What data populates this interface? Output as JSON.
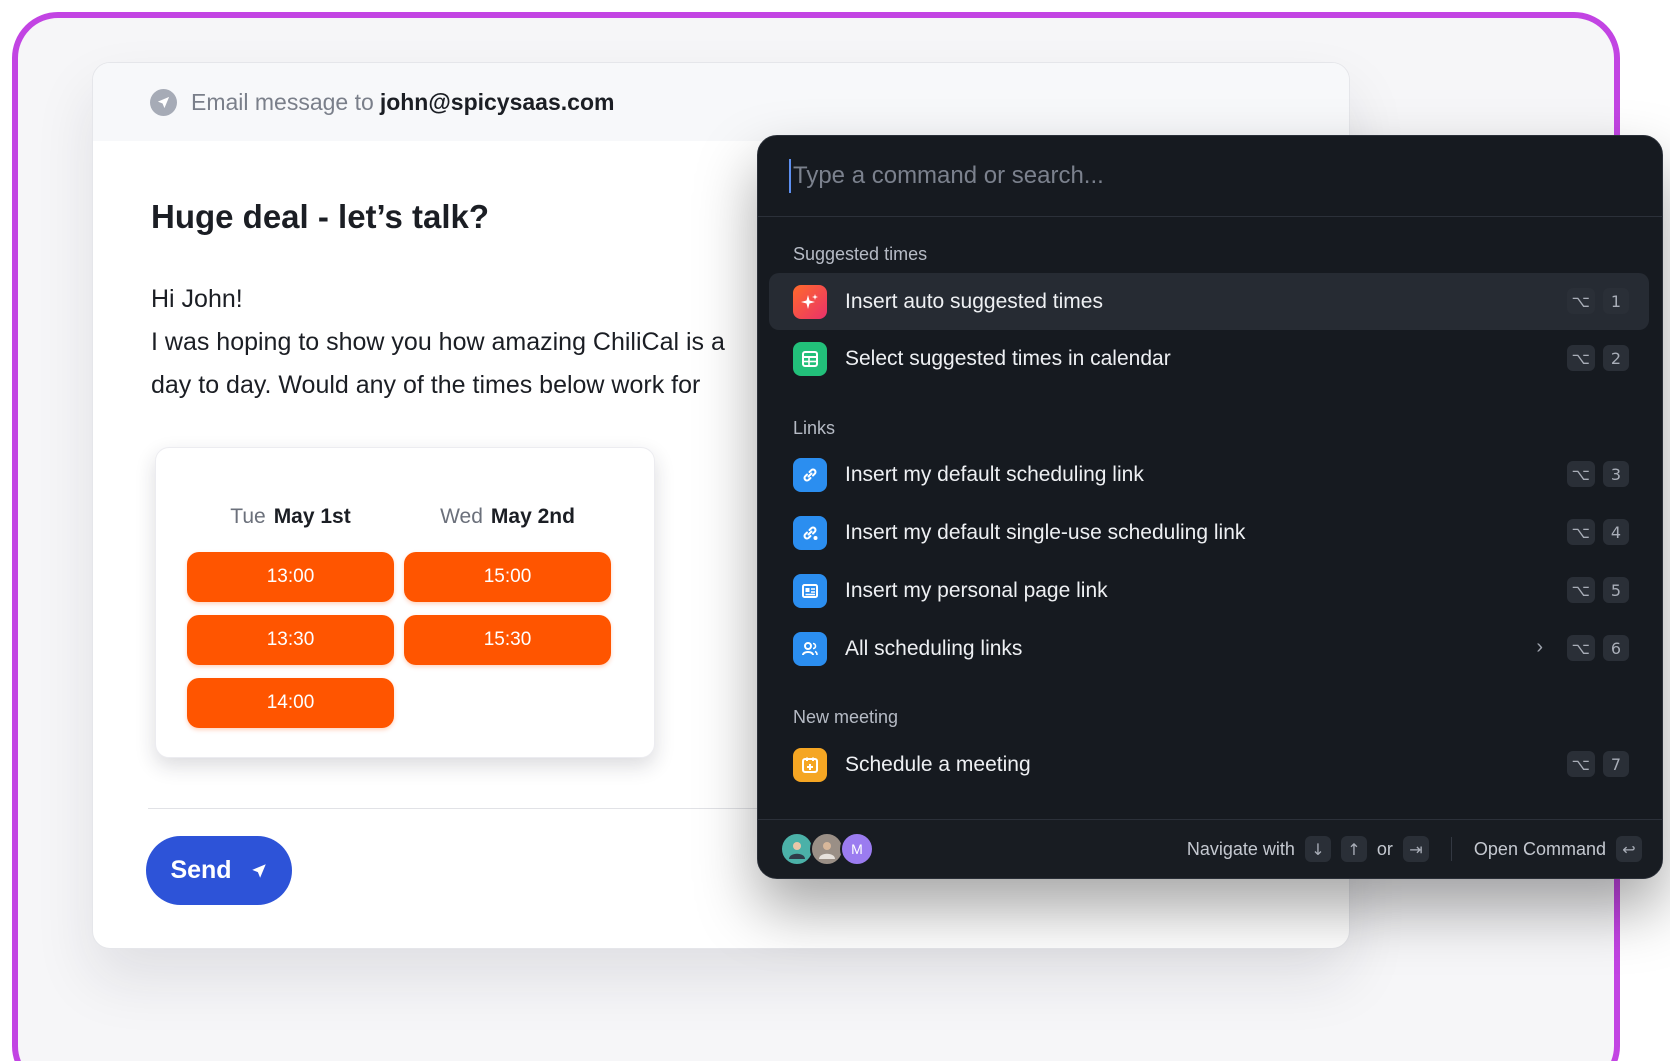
{
  "email": {
    "header_prefix": "Email message to",
    "recipient": "john@spicysaas.com",
    "subject": "Huge deal - let’s talk?",
    "greeting": "Hi John!",
    "line1": "I was hoping to show you how amazing ChiliCal is a",
    "line2": "day to day. Would any of the times below work for",
    "send_label": "Send"
  },
  "slots": {
    "days": [
      {
        "weekday": "Tue",
        "date": "May 1st",
        "times": [
          "13:00",
          "13:30",
          "14:00"
        ]
      },
      {
        "weekday": "Wed",
        "date": "May 2nd",
        "times": [
          "15:00",
          "15:30"
        ]
      }
    ],
    "accent": "#ff5500"
  },
  "palette": {
    "placeholder": "Type a command or search...",
    "sections": {
      "suggested": "Suggested times",
      "links": "Links",
      "new_meeting": "New meeting"
    },
    "items": [
      {
        "label": "Insert auto suggested times",
        "icon": "sparkle-icon",
        "mod": "⌥",
        "num": "1",
        "color": "#f2463a"
      },
      {
        "label": "Select suggested times in calendar",
        "icon": "calendar-grid-icon",
        "mod": "⌥",
        "num": "2",
        "color": "#22c07a"
      },
      {
        "label": "Insert my default scheduling link",
        "icon": "link-icon",
        "mod": "⌥",
        "num": "3",
        "color": "#2b8ef0"
      },
      {
        "label": "Insert my default single-use scheduling link",
        "icon": "single-use-link-icon",
        "mod": "⌥",
        "num": "4",
        "color": "#2b8ef0"
      },
      {
        "label": "Insert my personal page link",
        "icon": "page-icon",
        "mod": "⌥",
        "num": "5",
        "color": "#2b8ef0"
      },
      {
        "label": "All scheduling links",
        "icon": "users-icon",
        "mod": "⌥",
        "num": "6",
        "color": "#2b8ef0"
      },
      {
        "label": "Schedule a meeting",
        "icon": "calendar-add-icon",
        "mod": "⌥",
        "num": "7",
        "color": "#f5a623"
      }
    ],
    "footer": {
      "navigate": "Navigate with",
      "down_key": "↓",
      "up_key": "↑",
      "or": "or",
      "tab_key": "⇥",
      "open": "Open Command",
      "enter_key": "↩",
      "avatar_initial": "M"
    }
  }
}
